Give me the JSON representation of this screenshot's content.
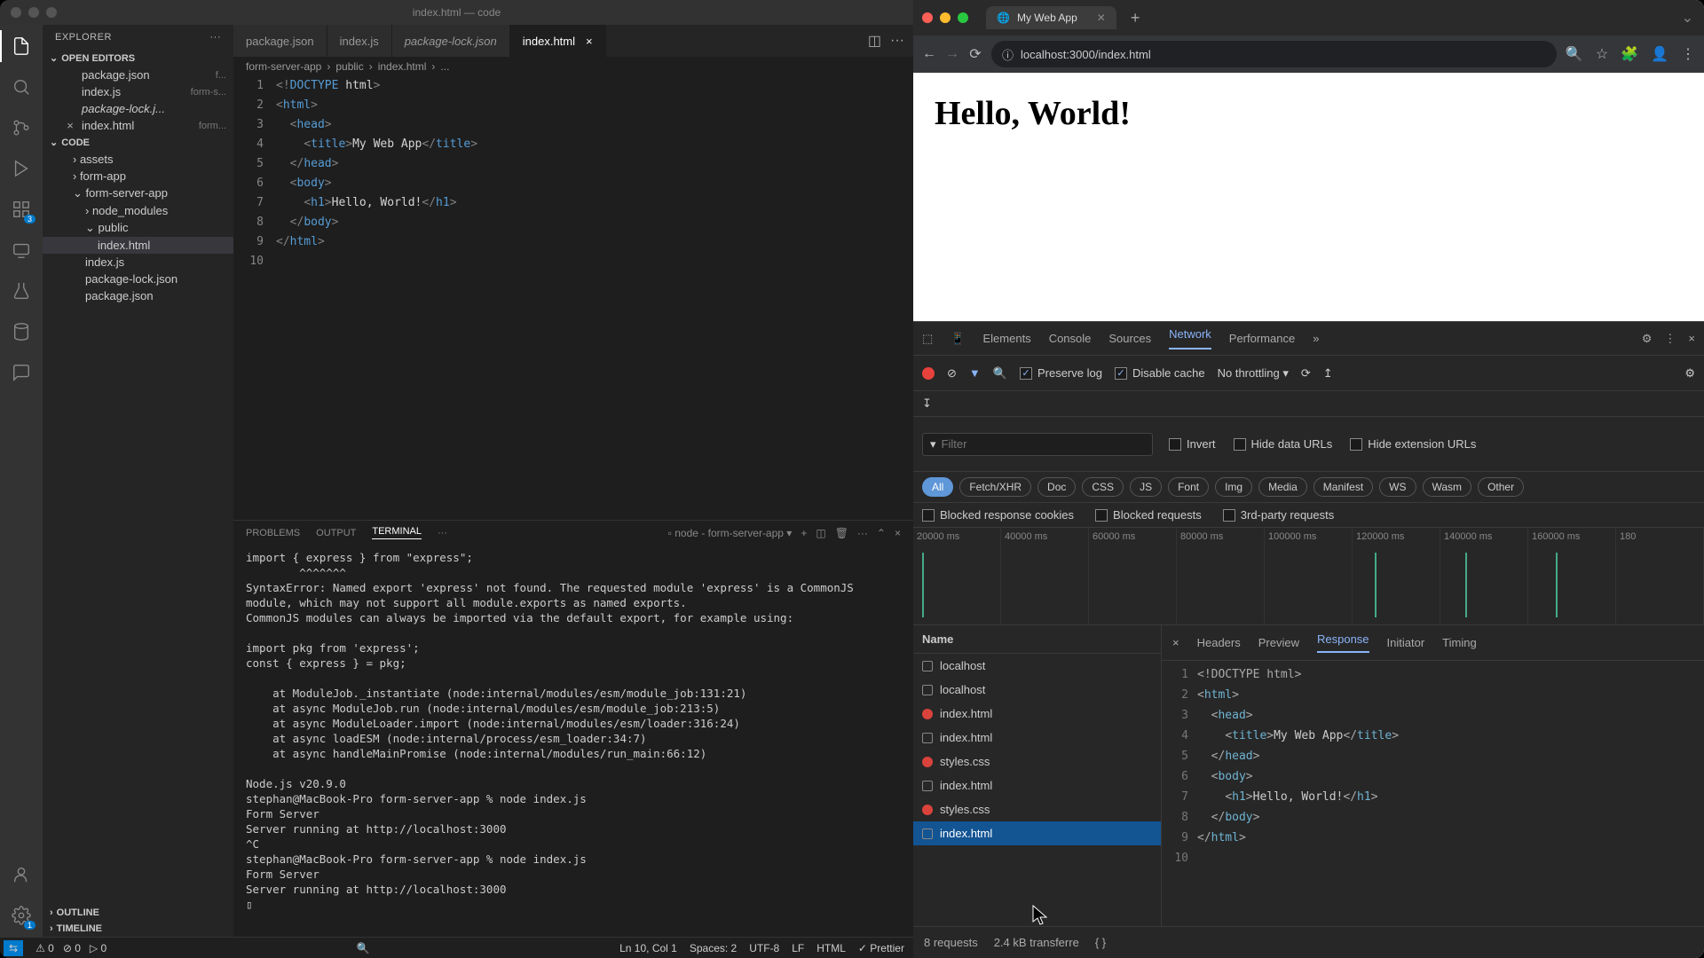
{
  "vscode": {
    "title": "index.html — code",
    "explorer": {
      "header": "EXPLORER",
      "openEditors": "OPEN EDITORS",
      "openFiles": [
        {
          "name": "package.json",
          "hint": "f..."
        },
        {
          "name": "index.js",
          "hint": "form-s..."
        },
        {
          "name": "package-lock.j...",
          "hint": "",
          "italic": true
        },
        {
          "name": "index.html",
          "hint": "form...",
          "close": true
        }
      ],
      "code": "CODE",
      "tree": [
        {
          "name": "assets",
          "type": "dir",
          "indent": 1
        },
        {
          "name": "form-app",
          "type": "dir",
          "indent": 1
        },
        {
          "name": "form-server-app",
          "type": "dir",
          "indent": 1,
          "expanded": true
        },
        {
          "name": "node_modules",
          "type": "dir",
          "indent": 2
        },
        {
          "name": "public",
          "type": "dir",
          "indent": 2,
          "expanded": true
        },
        {
          "name": "index.html",
          "type": "file",
          "indent": 3,
          "selected": true
        },
        {
          "name": "index.js",
          "type": "file",
          "indent": 2
        },
        {
          "name": "package-lock.json",
          "type": "file",
          "indent": 2
        },
        {
          "name": "package.json",
          "type": "file",
          "indent": 2
        }
      ],
      "outline": "OUTLINE",
      "timeline": "TIMELINE"
    },
    "tabs": [
      {
        "label": "package.json",
        "icon": "json"
      },
      {
        "label": "index.js",
        "icon": "js"
      },
      {
        "label": "package-lock.json",
        "icon": "json",
        "italic": true
      },
      {
        "label": "index.html",
        "icon": "html",
        "active": true,
        "close": true
      }
    ],
    "breadcrumb": [
      "form-server-app",
      "public",
      "index.html",
      "..."
    ],
    "code": {
      "lines": [
        {
          "n": 1,
          "html": "<span class='brk'>&lt;!</span><span class='doct'>DOCTYPE</span> <span class='txt'>html</span><span class='brk'>&gt;</span>"
        },
        {
          "n": 2,
          "html": "<span class='brk'>&lt;</span><span class='tag'>html</span><span class='brk'>&gt;</span>"
        },
        {
          "n": 3,
          "html": "  <span class='brk'>&lt;</span><span class='tag'>head</span><span class='brk'>&gt;</span>"
        },
        {
          "n": 4,
          "html": "    <span class='brk'>&lt;</span><span class='tag'>title</span><span class='brk'>&gt;</span>My Web App<span class='brk'>&lt;/</span><span class='tag'>title</span><span class='brk'>&gt;</span>"
        },
        {
          "n": 5,
          "html": "  <span class='brk'>&lt;/</span><span class='tag'>head</span><span class='brk'>&gt;</span>"
        },
        {
          "n": 6,
          "html": "  <span class='brk'>&lt;</span><span class='tag'>body</span><span class='brk'>&gt;</span>"
        },
        {
          "n": 7,
          "html": "    <span class='brk'>&lt;</span><span class='tag'>h1</span><span class='brk'>&gt;</span>Hello, World!<span class='brk'>&lt;/</span><span class='tag'>h1</span><span class='brk'>&gt;</span>"
        },
        {
          "n": 8,
          "html": "  <span class='brk'>&lt;/</span><span class='tag'>body</span><span class='brk'>&gt;</span>"
        },
        {
          "n": 9,
          "html": "<span class='brk'>&lt;/</span><span class='tag'>html</span><span class='brk'>&gt;</span>"
        },
        {
          "n": 10,
          "html": ""
        }
      ]
    },
    "panel": {
      "tabs": [
        "PROBLEMS",
        "OUTPUT",
        "TERMINAL",
        "···"
      ],
      "active": "TERMINAL",
      "task": "node - form-server-app",
      "terminal": "import { express } from \"express\";\n        ^^^^^^^\nSyntaxError: Named export 'express' not found. The requested module 'express' is a CommonJS module, which may not support all module.exports as named exports.\nCommonJS modules can always be imported via the default export, for example using:\n\nimport pkg from 'express';\nconst { express } = pkg;\n\n    at ModuleJob._instantiate (node:internal/modules/esm/module_job:131:21)\n    at async ModuleJob.run (node:internal/modules/esm/module_job:213:5)\n    at async ModuleLoader.import (node:internal/modules/esm/loader:316:24)\n    at async loadESM (node:internal/process/esm_loader:34:7)\n    at async handleMainPromise (node:internal/modules/run_main:66:12)\n\nNode.js v20.9.0\nstephan@MacBook-Pro form-server-app % node index.js\nForm Server\nServer running at http://localhost:3000\n^C\nstephan@MacBook-Pro form-server-app % node index.js\nForm Server\nServer running at http://localhost:3000\n▯"
    },
    "status": {
      "left": [
        "⚠ 0",
        "⊘ 0",
        "▷ 0"
      ],
      "right": [
        "Ln 10, Col 1",
        "Spaces: 2",
        "UTF-8",
        "LF",
        "HTML",
        "✓ Prettier"
      ]
    }
  },
  "chrome": {
    "tabTitle": "My Web App",
    "url": "localhost:3000/index.html",
    "pageHeading": "Hello, World!",
    "devtools": {
      "tabs": [
        "Elements",
        "Console",
        "Sources",
        "Network",
        "Performance"
      ],
      "active": "Network",
      "preserveLog": "Preserve log",
      "disableCache": "Disable cache",
      "throttling": "No throttling",
      "filterPlaceholder": "Filter",
      "filterCbs": [
        "Invert",
        "Hide data URLs",
        "Hide extension URLs"
      ],
      "typeChips": [
        "All",
        "Fetch/XHR",
        "Doc",
        "CSS",
        "JS",
        "Font",
        "Img",
        "Media",
        "Manifest",
        "WS",
        "Wasm",
        "Other"
      ],
      "blockCbs": [
        "Blocked response cookies",
        "Blocked requests",
        "3rd-party requests"
      ],
      "timelineTicks": [
        "20000 ms",
        "40000 ms",
        "60000 ms",
        "80000 ms",
        "100000 ms",
        "120000 ms",
        "140000 ms",
        "160000 ms",
        "180"
      ],
      "nameHeader": "Name",
      "requests": [
        {
          "name": "localhost",
          "status": "ok"
        },
        {
          "name": "localhost",
          "status": "ok"
        },
        {
          "name": "index.html",
          "status": "err"
        },
        {
          "name": "index.html",
          "status": "ok"
        },
        {
          "name": "styles.css",
          "status": "err"
        },
        {
          "name": "index.html",
          "status": "ok"
        },
        {
          "name": "styles.css",
          "status": "err"
        },
        {
          "name": "index.html",
          "status": "ok",
          "selected": true
        }
      ],
      "respTabs": [
        "Headers",
        "Preview",
        "Response",
        "Initiator",
        "Timing"
      ],
      "respActive": "Response",
      "respCode": [
        {
          "n": 1,
          "html": "<span class='r-brk'>&lt;!DOCTYPE html&gt;</span>"
        },
        {
          "n": 2,
          "html": "<span class='r-brk'>&lt;</span><span class='r-tag'>html</span><span class='r-brk'>&gt;</span>"
        },
        {
          "n": 3,
          "html": "  <span class='r-brk'>&lt;</span><span class='r-tag'>head</span><span class='r-brk'>&gt;</span>"
        },
        {
          "n": 4,
          "html": "    <span class='r-brk'>&lt;</span><span class='r-tag'>title</span><span class='r-brk'>&gt;</span>My Web App<span class='r-brk'>&lt;/</span><span class='r-tag'>title</span><span class='r-brk'>&gt;</span>"
        },
        {
          "n": 5,
          "html": "  <span class='r-brk'>&lt;/</span><span class='r-tag'>head</span><span class='r-brk'>&gt;</span>"
        },
        {
          "n": 6,
          "html": "  <span class='r-brk'>&lt;</span><span class='r-tag'>body</span><span class='r-brk'>&gt;</span>"
        },
        {
          "n": 7,
          "html": "    <span class='r-brk'>&lt;</span><span class='r-tag'>h1</span><span class='r-brk'>&gt;</span>Hello, World!<span class='r-brk'>&lt;/</span><span class='r-tag'>h1</span><span class='r-brk'>&gt;</span>"
        },
        {
          "n": 8,
          "html": "  <span class='r-brk'>&lt;/</span><span class='r-tag'>body</span><span class='r-brk'>&gt;</span>"
        },
        {
          "n": 9,
          "html": "<span class='r-brk'>&lt;/</span><span class='r-tag'>html</span><span class='r-brk'>&gt;</span>"
        },
        {
          "n": 10,
          "html": ""
        }
      ],
      "status": [
        "8 requests",
        "2.4 kB transferre",
        "{ }"
      ]
    }
  }
}
